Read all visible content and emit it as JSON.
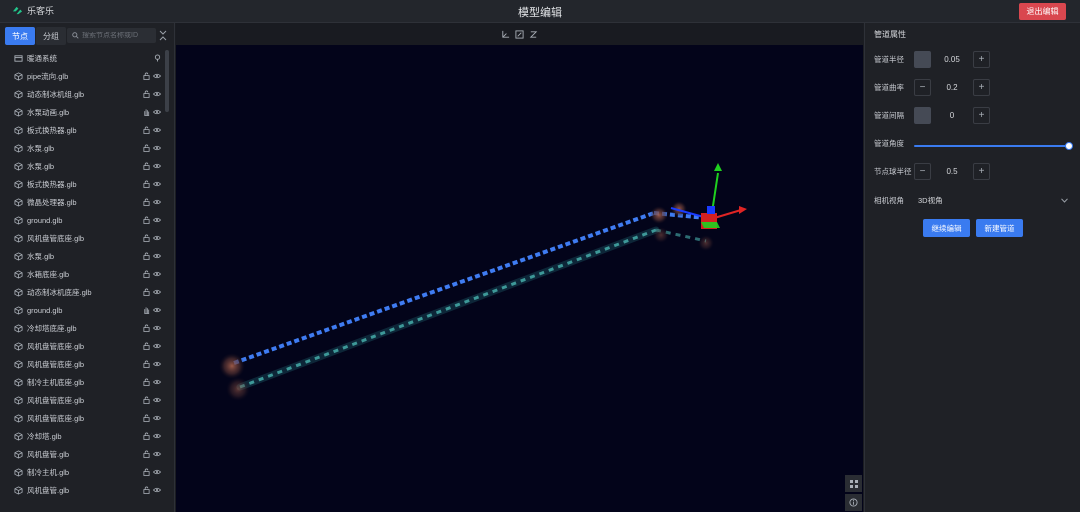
{
  "app": {
    "name": "乐客乐",
    "title": "模型编辑",
    "exit_label": "退出编辑"
  },
  "left": {
    "tabs": [
      {
        "label": "节点",
        "active": true
      },
      {
        "label": "分组",
        "active": false
      }
    ],
    "search_placeholder": "搜索节点名称或ID",
    "items": [
      {
        "label": "暖通系统",
        "icon": "layer-icon",
        "actions": [
          "pin-icon"
        ]
      },
      {
        "label": "pipe流向.glb",
        "icon": "cube-icon",
        "actions": [
          "lock-open-icon",
          "eye-icon"
        ]
      },
      {
        "label": "动态制冰机组.glb",
        "icon": "cube-icon",
        "actions": [
          "lock-open-icon",
          "eye-icon"
        ]
      },
      {
        "label": "水泵动画.glb",
        "icon": "cube-icon",
        "actions": [
          "hand-icon",
          "eye-icon"
        ]
      },
      {
        "label": "板式换热器.glb",
        "icon": "cube-icon",
        "actions": [
          "lock-open-icon",
          "eye-icon"
        ]
      },
      {
        "label": "水泵.glb",
        "icon": "cube-icon",
        "actions": [
          "lock-open-icon",
          "eye-icon"
        ]
      },
      {
        "label": "水泵.glb",
        "icon": "cube-icon",
        "actions": [
          "lock-open-icon",
          "eye-icon"
        ]
      },
      {
        "label": "板式换热器.glb",
        "icon": "cube-icon",
        "actions": [
          "lock-open-icon",
          "eye-icon"
        ]
      },
      {
        "label": "微晶处理器.glb",
        "icon": "cube-icon",
        "actions": [
          "lock-open-icon",
          "eye-icon"
        ]
      },
      {
        "label": "ground.glb",
        "icon": "cube-icon",
        "actions": [
          "lock-open-icon",
          "eye-icon"
        ]
      },
      {
        "label": "风机盘管底座.glb",
        "icon": "cube-icon",
        "actions": [
          "lock-open-icon",
          "eye-icon"
        ]
      },
      {
        "label": "水泵.glb",
        "icon": "cube-icon",
        "actions": [
          "lock-open-icon",
          "eye-icon"
        ]
      },
      {
        "label": "水箱底座.glb",
        "icon": "cube-icon",
        "actions": [
          "lock-open-icon",
          "eye-icon"
        ]
      },
      {
        "label": "动态制冰机底座.glb",
        "icon": "cube-icon",
        "actions": [
          "lock-open-icon",
          "eye-icon"
        ]
      },
      {
        "label": "ground.glb",
        "icon": "cube-icon",
        "actions": [
          "hand-icon",
          "eye-icon"
        ]
      },
      {
        "label": "冷却塔底座.glb",
        "icon": "cube-icon",
        "actions": [
          "lock-open-icon",
          "eye-icon"
        ]
      },
      {
        "label": "风机盘管底座.glb",
        "icon": "cube-icon",
        "actions": [
          "lock-open-icon",
          "eye-icon"
        ]
      },
      {
        "label": "风机盘管底座.glb",
        "icon": "cube-icon",
        "actions": [
          "lock-open-icon",
          "eye-icon"
        ]
      },
      {
        "label": "制冷主机底座.glb",
        "icon": "cube-icon",
        "actions": [
          "lock-open-icon",
          "eye-icon"
        ]
      },
      {
        "label": "风机盘管底座.glb",
        "icon": "cube-icon",
        "actions": [
          "lock-open-icon",
          "eye-icon"
        ]
      },
      {
        "label": "风机盘管底座.glb",
        "icon": "cube-icon",
        "actions": [
          "lock-open-icon",
          "eye-icon"
        ]
      },
      {
        "label": "冷却塔.glb",
        "icon": "cube-icon",
        "actions": [
          "lock-open-icon",
          "eye-icon"
        ]
      },
      {
        "label": "风机盘管.glb",
        "icon": "cube-icon",
        "actions": [
          "lock-open-icon",
          "eye-icon"
        ]
      },
      {
        "label": "制冷主机.glb",
        "icon": "cube-icon",
        "actions": [
          "lock-open-icon",
          "eye-icon"
        ]
      },
      {
        "label": "风机盘管.glb",
        "icon": "cube-icon",
        "actions": [
          "lock-open-icon",
          "eye-icon"
        ]
      }
    ]
  },
  "viewport": {
    "toolbar_icons": [
      "axes-icon",
      "edit-box-icon",
      "rotate-icon"
    ],
    "side_icons": [
      "fullscreen-icon",
      "info-icon"
    ],
    "colors": {
      "background": "#03041a",
      "pipe_blue": "#3f7cf2",
      "pipe_glow": "#2f6f7a",
      "axis_x": "#e02424",
      "axis_y": "#1fd11f",
      "axis_z": "#1a3cff"
    }
  },
  "right": {
    "section_title": "管道属性",
    "props": [
      {
        "label": "管道半径",
        "value": "0.05",
        "minus_filled": true
      },
      {
        "label": "管道曲率",
        "value": "0.2",
        "minus_filled": false
      },
      {
        "label": "管道间隔",
        "value": "0",
        "minus_filled": true
      }
    ],
    "angle": {
      "label": "管道角度",
      "value_fraction": 1.0
    },
    "sphere": {
      "label": "节点球半径",
      "value": "0.5"
    },
    "camera": {
      "label": "相机视角",
      "value": "3D视角"
    },
    "buttons": {
      "continue": "继续编辑",
      "new_pipe": "新建管道"
    }
  }
}
